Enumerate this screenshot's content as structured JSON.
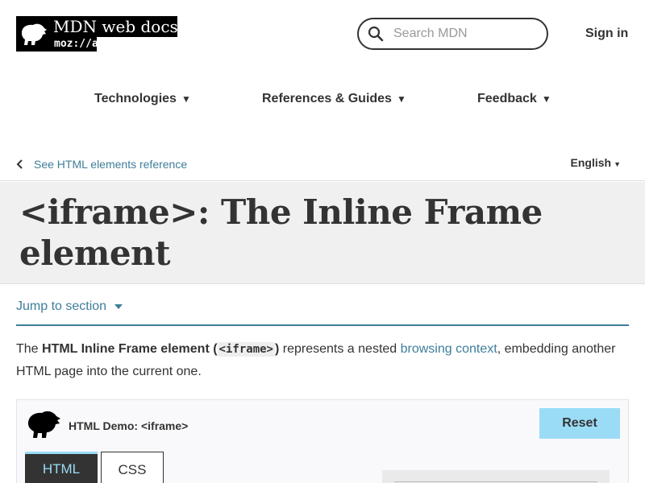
{
  "header": {
    "logo_title": "MDN web docs",
    "logo_sub": "moz://a",
    "search_placeholder": "Search MDN",
    "signin_label": "Sign in"
  },
  "nav": {
    "items": [
      {
        "label": "Technologies",
        "caret": "▼"
      },
      {
        "label": "References & Guides",
        "caret": "▼"
      },
      {
        "label": "Feedback",
        "caret": "▼"
      }
    ]
  },
  "breadcrumb": {
    "back_label": "See HTML elements reference",
    "language": "English",
    "language_caret": "▼"
  },
  "page": {
    "title": "<iframe>: The Inline Frame element",
    "jump_label": "Jump to section",
    "intro": {
      "t1": "The ",
      "strong1": "HTML Inline Frame element (",
      "code": "<iframe>",
      "strong2": ")",
      "t2": " represents a nested ",
      "link": "browsing context",
      "t3": ", embedding another HTML page into the current one."
    }
  },
  "demo": {
    "title": "HTML Demo: <iframe>",
    "reset_label": "Reset",
    "tabs": [
      {
        "label": "HTML",
        "active": true
      },
      {
        "label": "CSS",
        "active": false
      }
    ]
  },
  "colors": {
    "link": "#3d7e9a",
    "accent": "#9adcf6",
    "title_band": "#f0f0f0"
  }
}
